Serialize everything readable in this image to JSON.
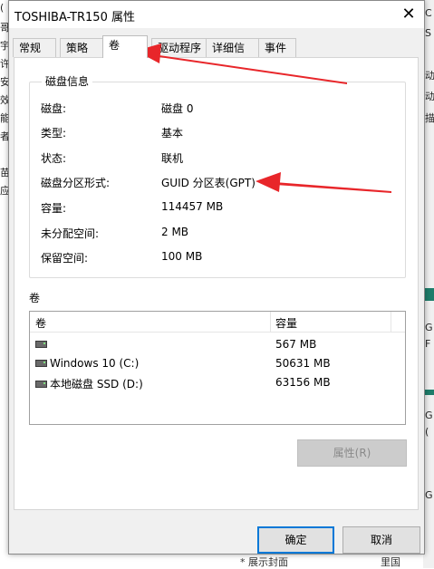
{
  "background": {
    "left_chars": [
      "(",
      "哥",
      "宇",
      "许",
      "安",
      "效",
      "能",
      "者",
      "苗",
      "应"
    ],
    "right_chars": [
      "C",
      "S",
      "动",
      "动",
      "描",
      "G",
      "F",
      "G",
      "(",
      "G"
    ],
    "bottom_text": "* 展示封面",
    "bottom_right_text": "里国"
  },
  "dialog": {
    "title": "TOSHIBA-TR150 属性",
    "close_label": "✕"
  },
  "tabs": [
    {
      "label": "常规"
    },
    {
      "label": "策略"
    },
    {
      "label": "卷"
    },
    {
      "label": "驱动程序"
    },
    {
      "label": "详细信息"
    },
    {
      "label": "事件"
    }
  ],
  "disk_info": {
    "group_title": "磁盘信息",
    "rows": [
      {
        "label": "磁盘:",
        "value": "磁盘 0"
      },
      {
        "label": "类型:",
        "value": "基本"
      },
      {
        "label": "状态:",
        "value": "联机"
      },
      {
        "label": "磁盘分区形式:",
        "value": "GUID 分区表(GPT)"
      },
      {
        "label": "容量:",
        "value": "114457 MB"
      },
      {
        "label": "未分配空间:",
        "value": "2 MB"
      },
      {
        "label": "保留空间:",
        "value": "100 MB"
      }
    ]
  },
  "volumes": {
    "label": "卷",
    "columns": [
      "卷",
      "容量"
    ],
    "rows": [
      {
        "name": "",
        "capacity": "567 MB"
      },
      {
        "name": "Windows 10 (C:)",
        "capacity": "50631 MB"
      },
      {
        "name": "本地磁盘 SSD (D:)",
        "capacity": "63156 MB"
      }
    ]
  },
  "buttons": {
    "properties": "属性(R)",
    "ok": "确定",
    "cancel": "取消"
  },
  "colors": {
    "annotation_arrow": "#e8262a",
    "accent": "#0078d7"
  }
}
